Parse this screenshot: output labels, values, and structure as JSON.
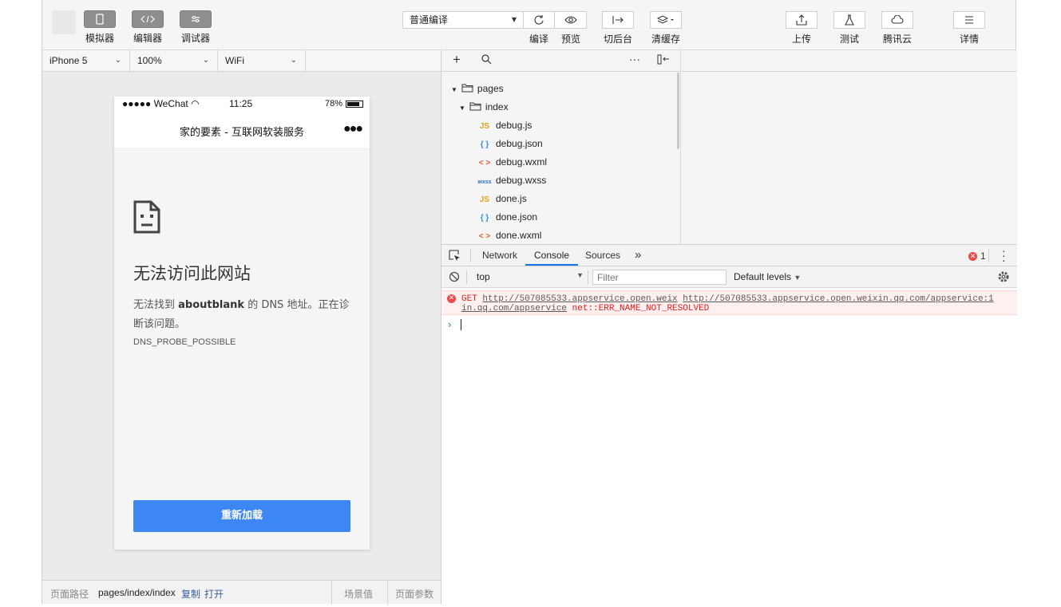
{
  "toolbar": {
    "simulator_label": "模拟器",
    "editor_label": "编辑器",
    "debugger_label": "调试器",
    "compile_mode": "普通编译",
    "compile_label": "编译",
    "preview_label": "预览",
    "background_label": "切后台",
    "clear_cache_label": "清缓存",
    "upload_label": "上传",
    "test_label": "测试",
    "tencent_cloud_label": "腾讯云",
    "details_label": "详情"
  },
  "simulator": {
    "device": "iPhone 5",
    "zoom": "100%",
    "network": "WiFi",
    "status_carrier": "●●●●● WeChat",
    "status_time": "11:25",
    "status_battery": "78%",
    "nav_title": "家的要素 - 互联网软装服务",
    "nav_more": "●●●",
    "error_title": "无法访问此网站",
    "error_desc_prefix": "无法找到 ",
    "error_desc_host": "aboutblank",
    "error_desc_suffix": " 的 DNS 地址。正在诊断该问题。",
    "error_code": "DNS_PROBE_POSSIBLE",
    "reload_label": "重新加载"
  },
  "footer": {
    "path_label": "页面路径",
    "path_value": "pages/index/index",
    "copy_label": "复制",
    "open_label": "打开",
    "scene_label": "场景值",
    "params_label": "页面参数"
  },
  "filetree": {
    "items": [
      {
        "name": "pages",
        "kind": "folder",
        "depth": 0
      },
      {
        "name": "index",
        "kind": "folder",
        "depth": 1
      },
      {
        "name": "debug.js",
        "kind": "js",
        "depth": 2
      },
      {
        "name": "debug.json",
        "kind": "json",
        "depth": 2
      },
      {
        "name": "debug.wxml",
        "kind": "wxml",
        "depth": 2
      },
      {
        "name": "debug.wxss",
        "kind": "wxss",
        "depth": 2
      },
      {
        "name": "done.js",
        "kind": "js",
        "depth": 2
      },
      {
        "name": "done.json",
        "kind": "json",
        "depth": 2
      },
      {
        "name": "done.wxml",
        "kind": "wxml",
        "depth": 2
      }
    ],
    "tags": {
      "js": "JS",
      "json": "{ }",
      "wxml": "< >",
      "wxss": "wxss"
    }
  },
  "devtools": {
    "tabs": [
      "Network",
      "Console",
      "Sources"
    ],
    "active_tab": "Console",
    "more_tabs": "»",
    "error_count": "1",
    "context": "top",
    "filter_placeholder": "Filter",
    "levels": "Default levels",
    "console_error": {
      "method": "GET",
      "url1": "http://507085533.appservice.open.weix",
      "url2a": "http://507085533.appservice.open.weixin.qq.com/appservice:1",
      "url2b": "in.qq.com/appservice",
      "message": "net::ERR_NAME_NOT_RESOLVED"
    },
    "prompt": "›"
  },
  "colors": {
    "accent_blue": "#3d87f4",
    "error_red": "#e02020",
    "tab_underline": "#1a73e8"
  }
}
